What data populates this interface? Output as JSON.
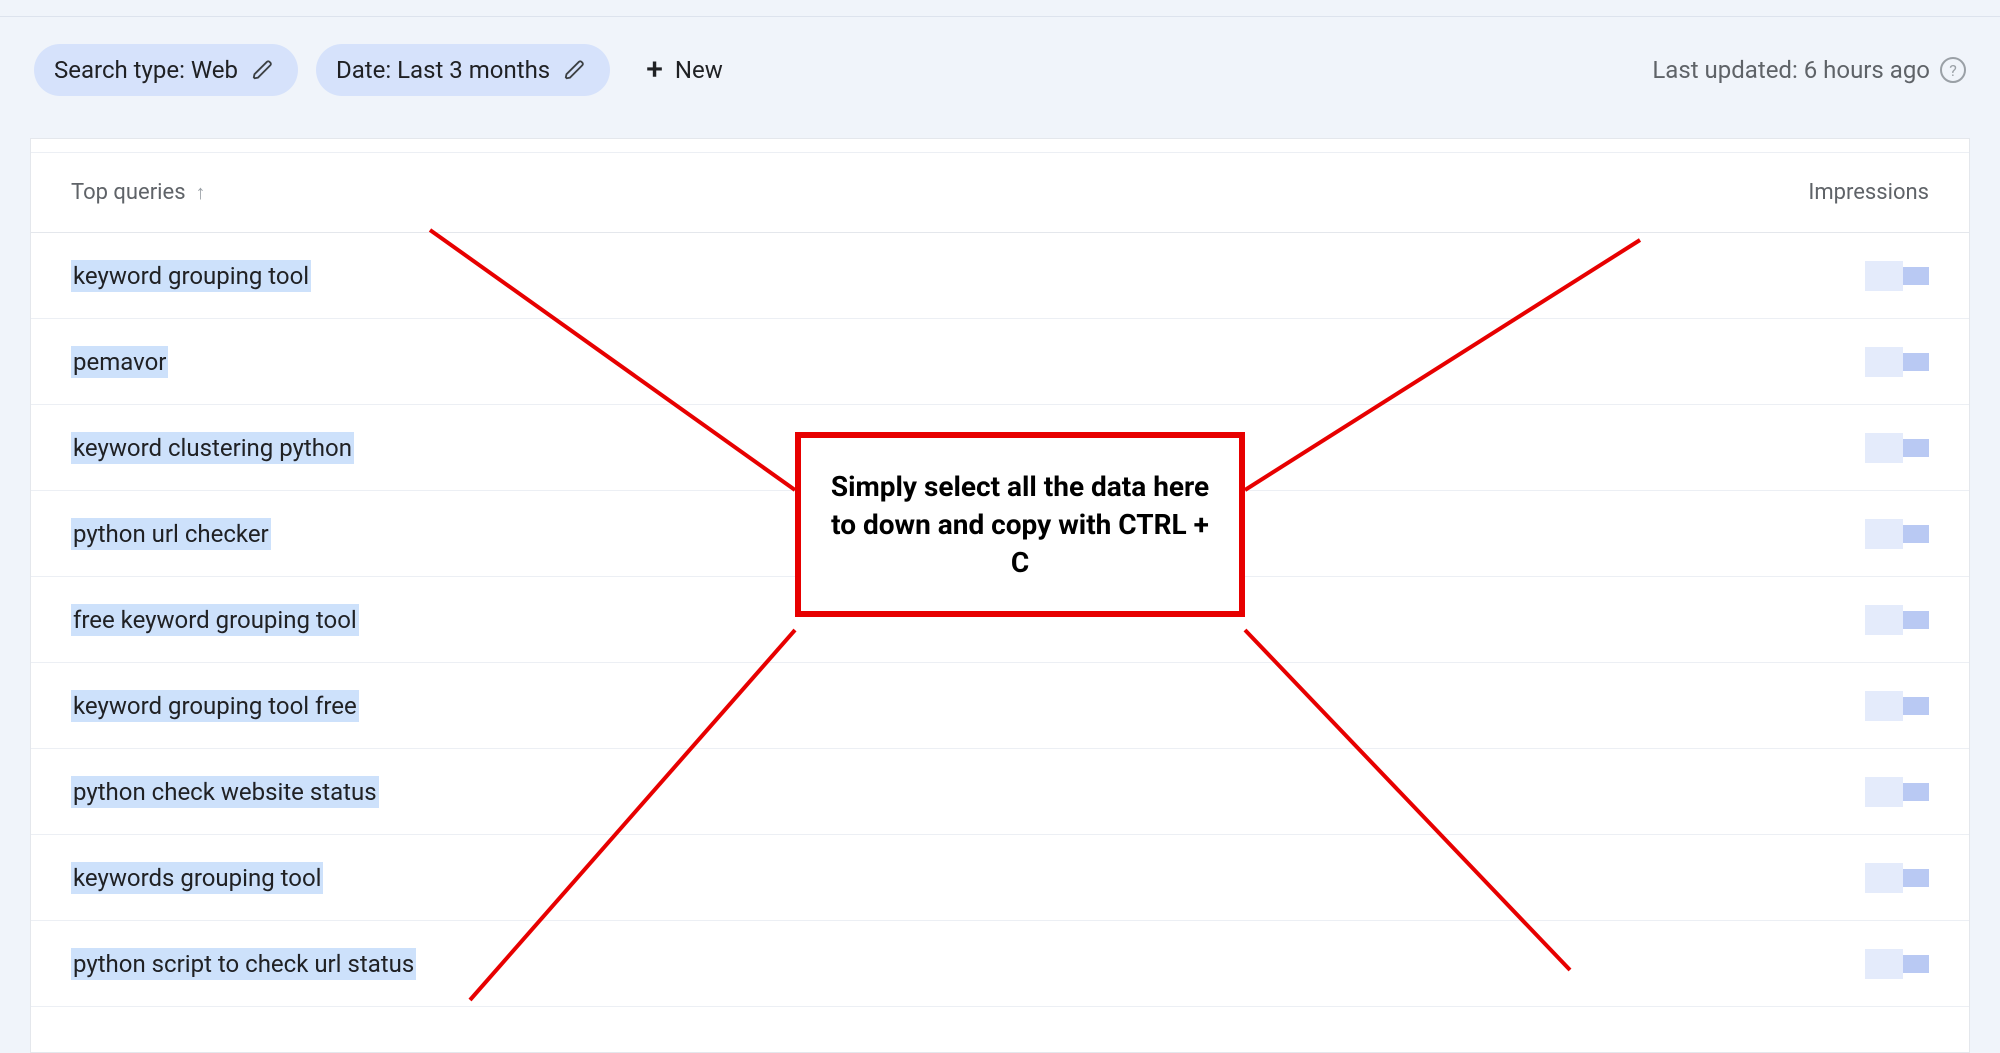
{
  "filters": {
    "search_type_chip": "Search type: Web",
    "date_chip": "Date: Last 3 months",
    "new_button": "New",
    "last_updated": "Last updated: 6 hours ago"
  },
  "table": {
    "header_left": "Top queries",
    "header_right": "Impressions",
    "rows": [
      {
        "query": "keyword grouping tool"
      },
      {
        "query": "pemavor"
      },
      {
        "query": "keyword clustering python"
      },
      {
        "query": "python url checker"
      },
      {
        "query": "free keyword grouping tool"
      },
      {
        "query": "keyword grouping tool free"
      },
      {
        "query": "python check website status"
      },
      {
        "query": "keywords grouping tool"
      },
      {
        "query": "python script to check url status"
      }
    ]
  },
  "callout": {
    "text": "Simply select all the data here to down and copy with CTRL + C"
  }
}
